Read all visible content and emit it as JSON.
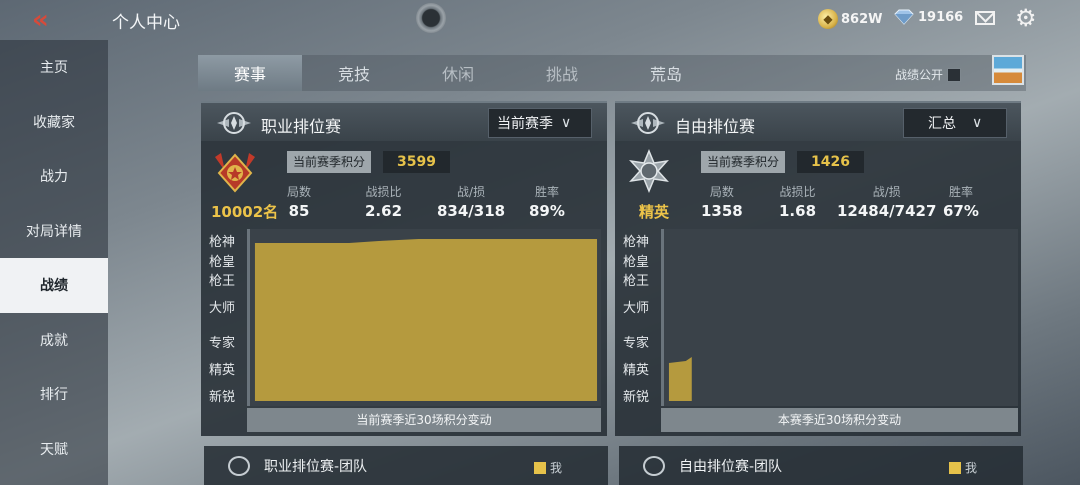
{
  "header": {
    "title": "个人中心",
    "gold": "862W",
    "diamonds": "19166"
  },
  "sidebar": {
    "items": [
      {
        "label": "主页"
      },
      {
        "label": "收藏家"
      },
      {
        "label": "战力"
      },
      {
        "label": "对局详情"
      },
      {
        "label": "战绩",
        "active": true
      },
      {
        "label": "成就"
      },
      {
        "label": "排行"
      },
      {
        "label": "天赋"
      }
    ]
  },
  "tabs": [
    {
      "label": "赛事",
      "active": true
    },
    {
      "label": "竞技"
    },
    {
      "label": "休闲"
    },
    {
      "label": "挑战"
    },
    {
      "label": "荒岛"
    }
  ],
  "public_toggle": {
    "label": "战绩公开",
    "checked": false
  },
  "panels": [
    {
      "title": "职业排位赛",
      "select": "当前赛季",
      "score_label": "当前赛季积分",
      "score": "3599",
      "rank": "10002名",
      "stats": [
        {
          "label": "局数",
          "value": "85"
        },
        {
          "label": "战损比",
          "value": "2.62"
        },
        {
          "label": "战/损",
          "value": "834/318"
        },
        {
          "label": "胜率",
          "value": "89%"
        }
      ],
      "tiers": [
        "枪神",
        "枪皇",
        "枪王",
        "大师",
        "专家",
        "精英",
        "新锐"
      ],
      "caption": "当前赛季近30场积分变动"
    },
    {
      "title": "自由排位赛",
      "select": "汇总",
      "score_label": "当前赛季积分",
      "score": "1426",
      "rank": "精英",
      "stats": [
        {
          "label": "局数",
          "value": "1358"
        },
        {
          "label": "战损比",
          "value": "1.68"
        },
        {
          "label": "战/损",
          "value": "12484/7427"
        },
        {
          "label": "胜率",
          "value": "67%"
        }
      ],
      "tiers": [
        "枪神",
        "枪皇",
        "枪王",
        "大师",
        "专家",
        "精英",
        "新锐"
      ],
      "caption": "本赛季近30场积分变动"
    }
  ],
  "team_panels": [
    {
      "title": "职业排位赛-团队",
      "legend": "我"
    },
    {
      "title": "自由排位赛-团队",
      "legend": "我"
    }
  ],
  "colors": {
    "accent_gold": "#e6c24a",
    "chart_fill": "#b59a3e",
    "active_sidebar": "#f0f2f4"
  },
  "icons": [
    "back-chevron-icon",
    "gold-coin-icon",
    "diamond-icon",
    "mail-icon",
    "gear-icon",
    "rank-emblem-icon",
    "team-icon"
  ]
}
